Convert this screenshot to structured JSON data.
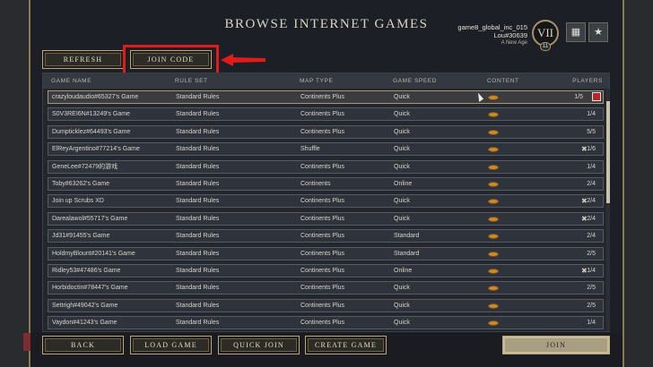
{
  "title": "BROWSE INTERNET GAMES",
  "player": {
    "name": "game8_global_inc_015",
    "id": "Lou#30639",
    "age": "A New Age",
    "era_numeral": "VII",
    "era_number": "11"
  },
  "header_icons": [
    "leaderboard-icon",
    "settings-grid-icon"
  ],
  "buttons": {
    "refresh": "REFRESH",
    "join_code": "JOIN CODE",
    "back": "BACK",
    "load_game": "LOAD GAME",
    "quick_join": "QUICK JOIN",
    "create_game": "CREATE GAME",
    "join": "JOIN"
  },
  "columns": {
    "name": "GAME NAME",
    "rules": "RULE SET",
    "map": "MAP TYPE",
    "speed": "GAME SPEED",
    "content": "CONTENT",
    "players": "PLAYERS"
  },
  "colors": {
    "accent_gold": "#b9a67a",
    "highlight_red": "#e01b1b",
    "content_icon": "#c98a2b"
  },
  "games": [
    {
      "name": "crazyloudaudio#65327's Game",
      "rules": "Standard Rules",
      "map": "Continents Plus",
      "speed": "Quick",
      "players": "1/5",
      "modded": false,
      "flag": true,
      "selected": true
    },
    {
      "name": "S0V3REI6N#13249's Game",
      "rules": "Standard Rules",
      "map": "Continents Plus",
      "speed": "Quick",
      "players": "1/4",
      "modded": false,
      "flag": false,
      "selected": false
    },
    {
      "name": "Dumpticklez#64493's Game",
      "rules": "Standard Rules",
      "map": "Continents Plus",
      "speed": "Quick",
      "players": "5/5",
      "modded": false,
      "flag": false,
      "selected": false
    },
    {
      "name": "ElReyArgentino#77214's Game",
      "rules": "Standard Rules",
      "map": "Shuffle",
      "speed": "Quick",
      "players": "1/6",
      "modded": true,
      "flag": false,
      "selected": false
    },
    {
      "name": "GeneLee#72479的游戏",
      "rules": "Standard Rules",
      "map": "Continents Plus",
      "speed": "Quick",
      "players": "1/4",
      "modded": false,
      "flag": false,
      "selected": false
    },
    {
      "name": "Toby#63262's Game",
      "rules": "Standard Rules",
      "map": "Continents",
      "speed": "Online",
      "players": "2/4",
      "modded": false,
      "flag": false,
      "selected": false
    },
    {
      "name": "Join up Scrubs XD",
      "rules": "Standard Rules",
      "map": "Continents Plus",
      "speed": "Quick",
      "players": "2/4",
      "modded": true,
      "flag": false,
      "selected": false
    },
    {
      "name": "Darealawol#55717's Game",
      "rules": "Standard Rules",
      "map": "Continents Plus",
      "speed": "Quick",
      "players": "2/4",
      "modded": true,
      "flag": false,
      "selected": false
    },
    {
      "name": "Jd31#91455's Game",
      "rules": "Standard Rules",
      "map": "Continents Plus",
      "speed": "Standard",
      "players": "2/4",
      "modded": false,
      "flag": false,
      "selected": false
    },
    {
      "name": "HoldmyBlount#20141's Game",
      "rules": "Standard Rules",
      "map": "Continents Plus",
      "speed": "Standard",
      "players": "2/5",
      "modded": false,
      "flag": false,
      "selected": false
    },
    {
      "name": "Ridley53#47486's Game",
      "rules": "Standard Rules",
      "map": "Continents Plus",
      "speed": "Online",
      "players": "1/4",
      "modded": true,
      "flag": false,
      "selected": false
    },
    {
      "name": "Horbidoctin#78447's Game",
      "rules": "Standard Rules",
      "map": "Continents Plus",
      "speed": "Quick",
      "players": "2/5",
      "modded": false,
      "flag": false,
      "selected": false
    },
    {
      "name": "Settrigh#49042's Game",
      "rules": "Standard Rules",
      "map": "Continents Plus",
      "speed": "Quick",
      "players": "2/5",
      "modded": false,
      "flag": false,
      "selected": false
    },
    {
      "name": "Vaydon#41243's Game",
      "rules": "Standard Rules",
      "map": "Continents Plus",
      "speed": "Quick",
      "players": "1/4",
      "modded": false,
      "flag": false,
      "selected": false
    }
  ]
}
